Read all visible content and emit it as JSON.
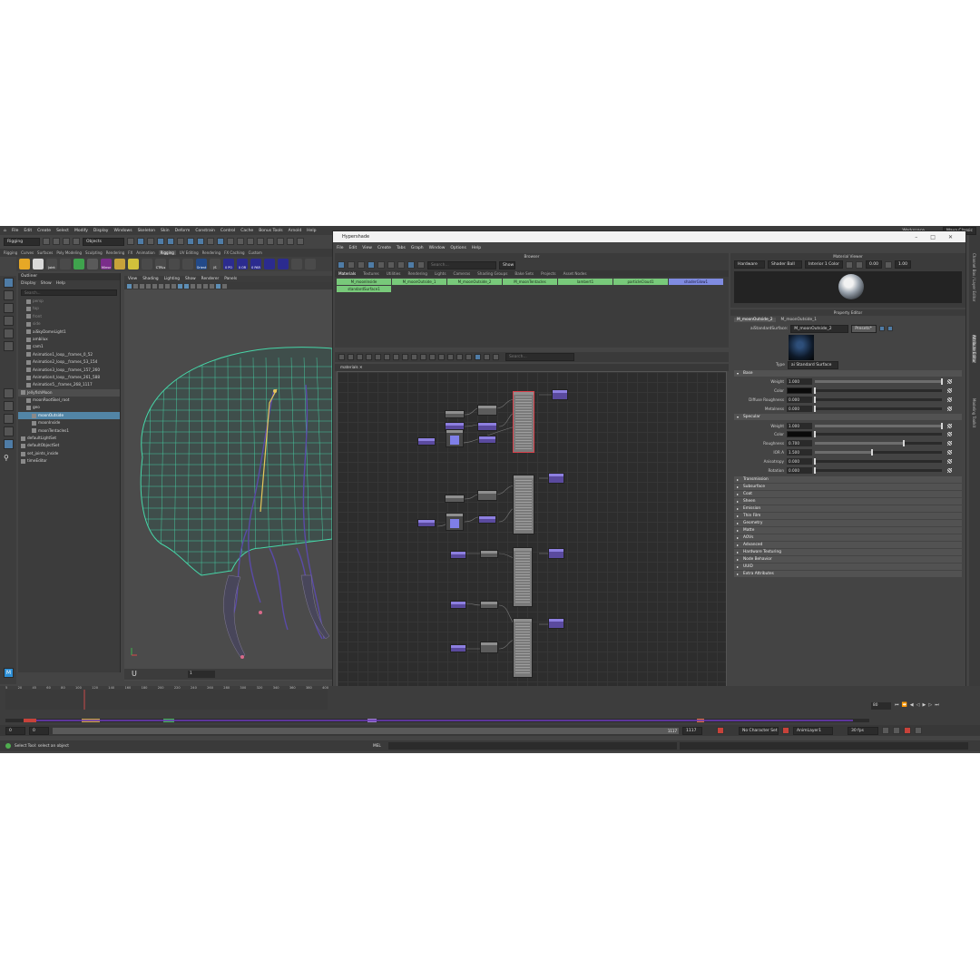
{
  "menubar": {
    "items": [
      "File",
      "Edit",
      "Create",
      "Select",
      "Modify",
      "Display",
      "Windows",
      "Skeleton",
      "Skin",
      "Deform",
      "Constrain",
      "Control",
      "Cache",
      "Bonus Tools",
      "Arnold",
      "Help"
    ],
    "workspace": "Workspace",
    "workspace_value": "Maya Classic"
  },
  "statusline": {
    "mode": "Rigging",
    "select": "Objects"
  },
  "shelf": {
    "tabs": [
      "Rigging",
      "Curves",
      "Surfaces",
      "Poly Modeling",
      "Sculpting",
      "Rendering",
      "FX",
      "Animation",
      "Rigging",
      "UV Editing",
      "Rendering",
      "FX Caching",
      "Custom"
    ],
    "active_tab": "Rigging",
    "buttons": [
      {
        "label": "",
        "color": "#e6a826"
      },
      {
        "label": "",
        "color": "#d9d9d9"
      },
      {
        "label": "Joint",
        "color": "#4a4a4a"
      },
      {
        "label": "",
        "color": "#4a4a4a"
      },
      {
        "label": "",
        "color": "#3fa34d"
      },
      {
        "label": "",
        "color": "#5a5a5a"
      },
      {
        "label": "Mirror",
        "color": "#7a2d8a"
      },
      {
        "label": "",
        "color": "#c7a23a"
      },
      {
        "label": "",
        "color": "#d1c13b"
      },
      {
        "label": "",
        "color": "#4a4a4a"
      },
      {
        "label": "CTRLs",
        "color": "#4a4a4a"
      },
      {
        "label": "",
        "color": "#4a4a4a"
      },
      {
        "label": "",
        "color": "#4a4a4a"
      },
      {
        "label": "Orient",
        "color": "#224a8a"
      },
      {
        "label": "JS",
        "color": "#4a4a4a"
      },
      {
        "label": "0 PO",
        "color": "#2b2b8f"
      },
      {
        "label": "0 OR",
        "color": "#2b2b8f"
      },
      {
        "label": "0 PAR",
        "color": "#2b2b8f"
      },
      {
        "label": "",
        "color": "#2b2b8f"
      },
      {
        "label": "",
        "color": "#2b2b8f"
      },
      {
        "label": "",
        "color": "#4a4a4a"
      },
      {
        "label": "",
        "color": "#4a4a4a"
      }
    ]
  },
  "outliner": {
    "title": "Outliner",
    "menu": [
      "Display",
      "Show",
      "Help"
    ],
    "search_placeholder": "Search...",
    "items": [
      {
        "label": "persp",
        "indent": 3,
        "state": "dim"
      },
      {
        "label": "top",
        "indent": 3,
        "state": "dim"
      },
      {
        "label": "front",
        "indent": 3,
        "state": "dim"
      },
      {
        "label": "side",
        "indent": 3,
        "state": "dim"
      },
      {
        "label": "aiSkyDomeLight1",
        "indent": 3,
        "state": ""
      },
      {
        "label": "ambilux",
        "indent": 3,
        "state": ""
      },
      {
        "label": "cam1",
        "indent": 3,
        "state": ""
      },
      {
        "label": "Animation1_loop__frames_0_52",
        "indent": 3,
        "state": ""
      },
      {
        "label": "Animation2_loop__frames_53_154",
        "indent": 3,
        "state": ""
      },
      {
        "label": "Animation3_loop__frames_157_260",
        "indent": 3,
        "state": ""
      },
      {
        "label": "Animation4_loop__frames_261_588",
        "indent": 3,
        "state": ""
      },
      {
        "label": "Animation5__frames_268_1117",
        "indent": 3,
        "state": ""
      },
      {
        "label": "JellyfishMoon",
        "indent": 1,
        "state": "hi"
      },
      {
        "label": "moonRootSkel_root",
        "indent": 3,
        "state": ""
      },
      {
        "label": "geo",
        "indent": 3,
        "state": ""
      },
      {
        "label": "moonOutside",
        "indent": 5,
        "state": "sel"
      },
      {
        "label": "moonInside",
        "indent": 5,
        "state": ""
      },
      {
        "label": "moonTentacles1",
        "indent": 5,
        "state": ""
      },
      {
        "label": "defaultLightSet",
        "indent": 1,
        "state": ""
      },
      {
        "label": "defaultObjectSet",
        "indent": 1,
        "state": ""
      },
      {
        "label": "set_joints_inside",
        "indent": 1,
        "state": ""
      },
      {
        "label": "timeEditor",
        "indent": 1,
        "state": ""
      }
    ]
  },
  "viewport": {
    "menu": [
      "View",
      "Shading",
      "Lighting",
      "Show",
      "Renderer",
      "Panels"
    ],
    "frame_field": "1"
  },
  "timeline": {
    "ticks": [
      "5",
      "20",
      "45",
      "60",
      "80",
      "100",
      "120",
      "140",
      "160",
      "180",
      "200",
      "220",
      "240",
      "260",
      "280",
      "300",
      "320",
      "340",
      "360",
      "380",
      "400"
    ],
    "current_frame": "80",
    "range_start": "0",
    "range_start2": "0",
    "range_end": "1117",
    "range_end2": "1117",
    "char_set": "No Character Set",
    "anim_layer": "AnimLayer1",
    "fps": "30 fps"
  },
  "cmdline": {
    "lang": "MEL",
    "help": "Select Tool: select an object"
  },
  "hypershade": {
    "title": "Hypershade",
    "menu": [
      "File",
      "Edit",
      "View",
      "Create",
      "Tabs",
      "Graph",
      "Window",
      "Options",
      "Help"
    ],
    "browser": {
      "title": "Browser",
      "search_placeholder": "Search...",
      "show_label": "Show",
      "tabs": [
        "Materials",
        "Textures",
        "Utilities",
        "Rendering",
        "Lights",
        "Cameras",
        "Shading Groups",
        "Bake Sets",
        "Projects",
        "Asset Nodes"
      ],
      "active_tab": "Materials",
      "materials": [
        "M_moonInside",
        "M_moonOutside_1",
        "M_moonOutside_2",
        "M_moonTentacles",
        "lambert1",
        "particleCloud1",
        "shaderGlow1",
        "standardSurface1"
      ],
      "selected_material": "shaderGlow1"
    },
    "graph": {
      "tab": "materials",
      "search_placeholder": "Search..."
    },
    "material_viewer": {
      "title": "Material Viewer",
      "renderer": "Hardware",
      "shape": "Shader Ball",
      "lighting": "Interior 1 Color",
      "exposure": "0.00",
      "gamma": "1.00"
    },
    "property_editor": {
      "title": "Property Editor",
      "tabs": [
        "M_moonOutside_2",
        "M_moonOutside_1"
      ],
      "node_type_label": "aiStandardSurface:",
      "node_name": "M_moonOutside_2",
      "presets": "Presets*",
      "type_label": "Type",
      "type_value": "ai Standard Surface",
      "base": {
        "title": "Base",
        "weight_label": "Weight",
        "weight": "1.000",
        "weight_level": 1.0,
        "color_label": "Color",
        "color": "#0a0a0a",
        "diffuse_label": "Diffuse Roughness",
        "diffuse": "0.000",
        "diffuse_level": 0.0,
        "metalness_label": "Metalness",
        "metalness": "0.000",
        "metalness_level": 0.0
      },
      "specular": {
        "title": "Specular",
        "weight_label": "Weight",
        "weight": "1.000",
        "weight_level": 1.0,
        "color_label": "Color",
        "color": "#0a0a0a",
        "roughness_label": "Roughness",
        "roughness": "0.700",
        "roughness_level": 0.7,
        "ior_label": "IOR A",
        "ior": "1.500",
        "ior_level": 0.45,
        "aniso_label": "Anisotropy",
        "aniso": "0.000",
        "aniso_level": 0.0,
        "rotation_label": "Rotation",
        "rotation": "0.000",
        "rotation_level": 0.0
      },
      "sections": [
        "Transmission",
        "Subsurface",
        "Coat",
        "Sheen",
        "Emission",
        "Thin Film",
        "Geometry",
        "Matte",
        "AOVs",
        "Advanced",
        "Hardware Texturing",
        "Node Behavior",
        "UUID",
        "Extra Attributes"
      ]
    }
  },
  "side_tabs": [
    "Channel Box / Layer Editor",
    "Attribute Editor",
    "Modeling Toolkit"
  ],
  "colors": {
    "selection": "#5285a6",
    "material_swatch": "#78c97a",
    "wireframe": "#47d6a8",
    "skeleton": "#5a4aa8"
  }
}
